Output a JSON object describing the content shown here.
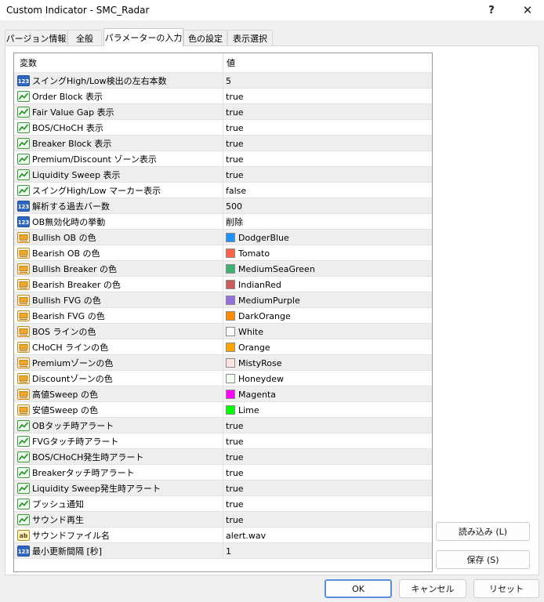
{
  "window": {
    "title": "Custom Indicator - SMC_Radar",
    "help": "?",
    "close": "✕"
  },
  "tabs": [
    {
      "label": "パージョン情報",
      "active": false
    },
    {
      "label": "全般",
      "active": false
    },
    {
      "label": "パラメーターの入力",
      "active": true
    },
    {
      "label": "色の設定",
      "active": false
    },
    {
      "label": "表示選択",
      "active": false
    }
  ],
  "grid": {
    "headers": {
      "name": "変数",
      "value": "値"
    },
    "rows": [
      {
        "icon": "numeric-icon",
        "name": "スイングHigh/Low検出の左右本数",
        "value": "5"
      },
      {
        "icon": "boolean-icon",
        "name": "Order Block 表示",
        "value": "true"
      },
      {
        "icon": "boolean-icon",
        "name": "Fair Value Gap 表示",
        "value": "true"
      },
      {
        "icon": "boolean-icon",
        "name": "BOS/CHoCH 表示",
        "value": "true"
      },
      {
        "icon": "boolean-icon",
        "name": "Breaker Block 表示",
        "value": "true"
      },
      {
        "icon": "boolean-icon",
        "name": "Premium/Discount ゾーン表示",
        "value": "true"
      },
      {
        "icon": "boolean-icon",
        "name": "Liquidity Sweep 表示",
        "value": "true"
      },
      {
        "icon": "boolean-icon",
        "name": "スイングHigh/Low マーカー表示",
        "value": "false"
      },
      {
        "icon": "numeric-icon",
        "name": "解析する過去バー数",
        "value": "500"
      },
      {
        "icon": "numeric-icon",
        "name": "OB無効化時の挙動",
        "value": "削除"
      },
      {
        "icon": "color-icon",
        "name": "Bullish OB の色",
        "value": "DodgerBlue",
        "swatch": "#1E90FF"
      },
      {
        "icon": "color-icon",
        "name": "Bearish OB の色",
        "value": "Tomato",
        "swatch": "#FF6347"
      },
      {
        "icon": "color-icon",
        "name": "Bullish Breaker の色",
        "value": "MediumSeaGreen",
        "swatch": "#3CB371"
      },
      {
        "icon": "color-icon",
        "name": "Bearish Breaker の色",
        "value": "IndianRed",
        "swatch": "#CD5C5C"
      },
      {
        "icon": "color-icon",
        "name": "Bullish FVG の色",
        "value": "MediumPurple",
        "swatch": "#9370DB"
      },
      {
        "icon": "color-icon",
        "name": "Bearish FVG の色",
        "value": "DarkOrange",
        "swatch": "#FF8C00"
      },
      {
        "icon": "color-icon",
        "name": "BOS ラインの色",
        "value": "White",
        "swatch": "#FFFFFF"
      },
      {
        "icon": "color-icon",
        "name": "CHoCH ラインの色",
        "value": "Orange",
        "swatch": "#FFA500"
      },
      {
        "icon": "color-icon",
        "name": "Premiumゾーンの色",
        "value": "MistyRose",
        "swatch": "#FFE4E1"
      },
      {
        "icon": "color-icon",
        "name": "Discountゾーンの色",
        "value": "Honeydew",
        "swatch": "#F0FFF0"
      },
      {
        "icon": "color-icon",
        "name": "高値Sweep の色",
        "value": "Magenta",
        "swatch": "#FF00FF"
      },
      {
        "icon": "color-icon",
        "name": "安値Sweep の色",
        "value": "Lime",
        "swatch": "#00FF00"
      },
      {
        "icon": "boolean-icon",
        "name": "OBタッチ時アラート",
        "value": "true"
      },
      {
        "icon": "boolean-icon",
        "name": "FVGタッチ時アラート",
        "value": "true"
      },
      {
        "icon": "boolean-icon",
        "name": "BOS/CHoCH発生時アラート",
        "value": "true"
      },
      {
        "icon": "boolean-icon",
        "name": "Breakerタッチ時アラート",
        "value": "true"
      },
      {
        "icon": "boolean-icon",
        "name": "Liquidity Sweep発生時アラート",
        "value": "true"
      },
      {
        "icon": "boolean-icon",
        "name": "プッシュ通知",
        "value": "true"
      },
      {
        "icon": "boolean-icon",
        "name": "サウンド再生",
        "value": "true"
      },
      {
        "icon": "string-icon",
        "name": "サウンドファイル名",
        "value": "alert.wav"
      },
      {
        "icon": "numeric-icon",
        "name": "最小更新間隔 [秒]",
        "value": "1"
      }
    ]
  },
  "buttons": {
    "load": "読み込み (L)",
    "save": "保存 (S)",
    "ok": "OK",
    "cancel": "キャンセル",
    "reset": "リセット"
  }
}
